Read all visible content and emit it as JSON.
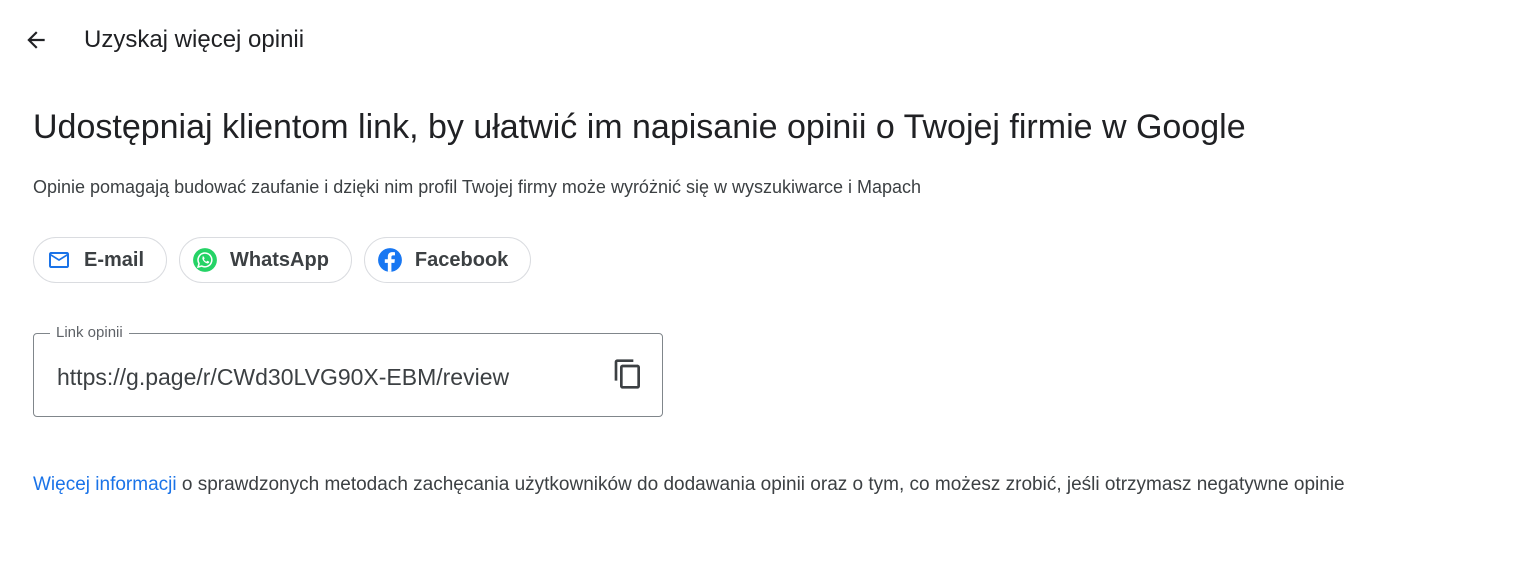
{
  "header": {
    "title": "Uzyskaj więcej opinii",
    "back_icon": "arrow-back-icon"
  },
  "main": {
    "headline": "Udostępniaj klientom link, by ułatwić im napisanie opinii o Twojej firmie w Google",
    "subtitle": "Opinie pomagają budować zaufanie i dzięki nim profil Twojej firmy może wyróżnić się w wyszukiwarce i Mapach",
    "share_chips": [
      {
        "label": "E-mail",
        "icon": "mail-icon"
      },
      {
        "label": "WhatsApp",
        "icon": "whatsapp-icon"
      },
      {
        "label": "Facebook",
        "icon": "facebook-icon"
      }
    ],
    "review_link": {
      "label": "Link opinii",
      "value": "https://g.page/r/CWd30LVG90X-EBM/review",
      "copy_icon": "copy-icon"
    },
    "footer": {
      "link_text": "Więcej informacji",
      "text": " o sprawdzonych metodach zachęcania użytkowników do dodawania opinii oraz o tym, co możesz zrobić, jeśli otrzymasz negatywne opinie"
    }
  },
  "colors": {
    "link": "#1a73e8",
    "mail": "#1a73e8",
    "whatsapp": "#25d366",
    "facebook": "#1877f2",
    "text": "#202124",
    "border": "#dadce0"
  }
}
